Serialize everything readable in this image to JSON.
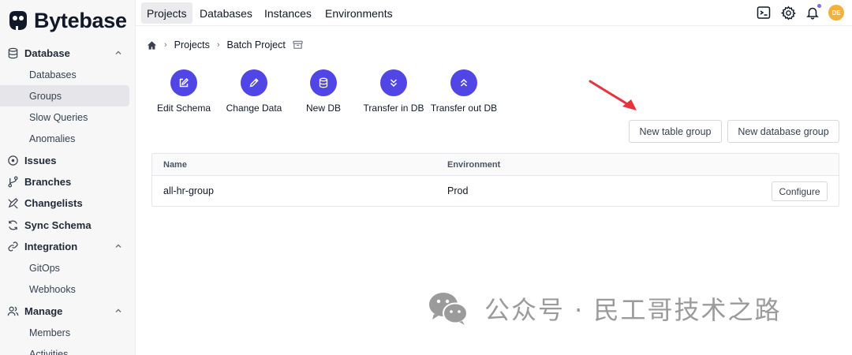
{
  "brand": {
    "name": "Bytebase"
  },
  "sidebar": {
    "groups": [
      {
        "label": "Database",
        "icon": "database-icon"
      },
      {
        "label": "Issues",
        "icon": "issues-icon"
      },
      {
        "label": "Branches",
        "icon": "branch-icon"
      },
      {
        "label": "Changelists",
        "icon": "changelist-icon"
      },
      {
        "label": "Sync Schema",
        "icon": "sync-icon"
      },
      {
        "label": "Integration",
        "icon": "integration-icon"
      },
      {
        "label": "Manage",
        "icon": "users-icon"
      }
    ],
    "database_items": [
      "Databases",
      "Groups",
      "Slow Queries",
      "Anomalies"
    ],
    "integration_items": [
      "GitOps",
      "Webhooks"
    ],
    "manage_items": [
      "Members",
      "Activities"
    ],
    "active_item": "Groups"
  },
  "topbar": {
    "tabs": [
      "Projects",
      "Databases",
      "Instances",
      "Environments"
    ],
    "active_tab": "Projects",
    "icons": [
      "terminal-icon",
      "gear-icon",
      "bell-icon"
    ],
    "avatar_initials": "DE",
    "avatar_color": "#f2b13a"
  },
  "breadcrumb": {
    "items": [
      "Projects",
      "Batch Project"
    ]
  },
  "actions": [
    {
      "label": "Edit Schema",
      "icon": "edit-schema-icon"
    },
    {
      "label": "Change Data",
      "icon": "pencil-icon"
    },
    {
      "label": "New DB",
      "icon": "database-icon"
    },
    {
      "label": "Transfer in DB",
      "icon": "chevrons-down-icon"
    },
    {
      "label": "Transfer out DB",
      "icon": "chevrons-up-icon"
    }
  ],
  "buttons": {
    "new_table_group": "New table group",
    "new_database_group": "New database group"
  },
  "table": {
    "columns": [
      "Name",
      "Environment"
    ],
    "rows": [
      {
        "name": "all-hr-group",
        "environment": "Prod",
        "action": "Configure"
      }
    ]
  },
  "watermark": {
    "text": "公众号 · 民工哥技术之路"
  },
  "colors": {
    "accent": "#4f46e5",
    "arrow": "#e8323c"
  }
}
